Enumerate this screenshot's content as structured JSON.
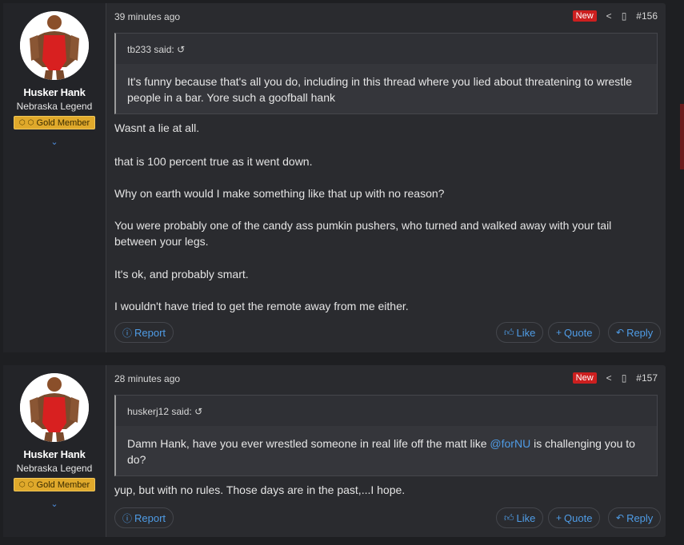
{
  "posts": [
    {
      "user": {
        "name": "Husker Hank",
        "title": "Nebraska Legend",
        "badge": "Gold Member"
      },
      "time": "39 minutes ago",
      "new_label": "New",
      "post_no": "#156",
      "quote": {
        "author": "tb233 said:",
        "text": "It's funny because that's all you do, including in this thread where you lied about threatening to wrestle people in a bar. Yore such a goofball hank"
      },
      "body": [
        "Wasnt a lie at all.",
        "that is 100 percent true as it went down.",
        "Why on earth would I make something like that up with no reason?",
        "You were probably one of the candy ass pumkin pushers, who turned and walked away with your tail\nbetween your legs.",
        "It's ok, and probably smart.",
        "I wouldn't have tried to get the remote away from me either."
      ],
      "actions": {
        "report": "Report",
        "like": "Like",
        "quote": "Quote",
        "reply": "Reply"
      }
    },
    {
      "user": {
        "name": "Husker Hank",
        "title": "Nebraska Legend",
        "badge": "Gold Member"
      },
      "time": "28 minutes ago",
      "new_label": "New",
      "post_no": "#157",
      "quote": {
        "author": "huskerj12 said:",
        "text_before": "Damn Hank, have you ever wrestled someone in real life off the matt like ",
        "mention": "@forNU",
        "text_after": " is challenging you to do?"
      },
      "body": [
        "yup, but with no rules. Those days are in the past,...I hope."
      ],
      "actions": {
        "report": "Report",
        "like": "Like",
        "quote": "Quote",
        "reply": "Reply"
      }
    }
  ],
  "colors": {
    "accent": "#4f9ce6",
    "new_badge": "#cc1f1f",
    "gold_badge": "#e0a92b"
  },
  "icons": {
    "expand": "chevron-down-icon",
    "share": "share-icon",
    "bookmark": "bookmark-icon",
    "quote_jump": "return-arrow-icon"
  }
}
